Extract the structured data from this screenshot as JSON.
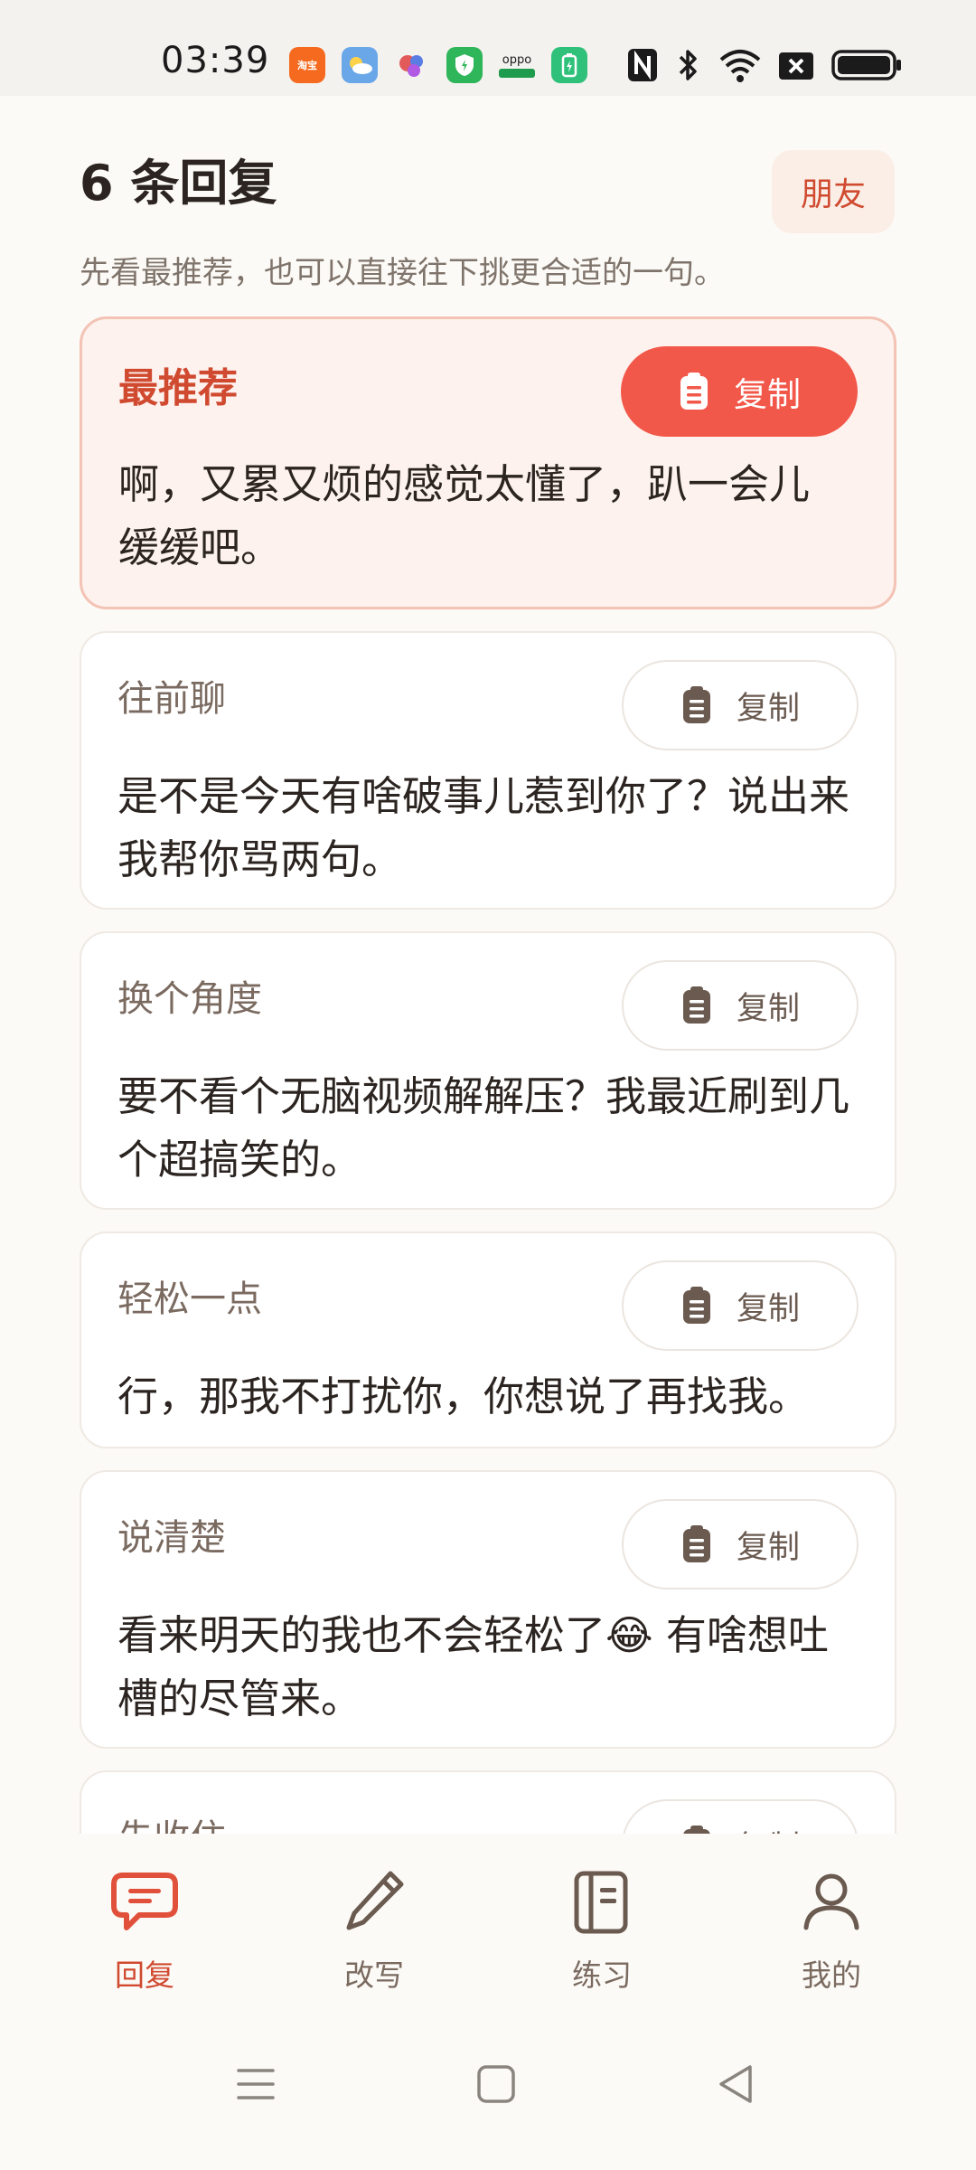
{
  "status_bar": {
    "time": "03:39",
    "app_icons": [
      {
        "name": "taobao-icon",
        "label": "淘宝",
        "color": "#f56a1f"
      },
      {
        "name": "weather-icon",
        "label": "",
        "color": "#6aa7e8"
      },
      {
        "name": "photos-icon",
        "label": "",
        "color": "#e36aa0"
      },
      {
        "name": "security-icon",
        "label": "",
        "color": "#2fb55a"
      },
      {
        "name": "oppo-icon",
        "label": "oppo",
        "color": "#1f9b4d"
      },
      {
        "name": "battery-app-icon",
        "label": "",
        "color": "#2fc17a"
      }
    ]
  },
  "header": {
    "title": "6 条回复",
    "friend_button": "朋友",
    "subtitle": "先看最推荐，也可以直接往下挑更合适的一句。"
  },
  "copy_label": "复制",
  "cards": [
    {
      "label": "最推荐",
      "text_lines": [
        "啊，又累又烦的感觉太懂了，趴一会儿",
        "缓缓吧。"
      ]
    },
    {
      "label": "往前聊",
      "text_lines": [
        "是不是今天有啥破事儿惹到你了？说出来",
        "我帮你骂两句。"
      ]
    },
    {
      "label": "换个角度",
      "text_lines": [
        "要不看个无脑视频解解压？我最近刷到几",
        "个超搞笑的。"
      ]
    },
    {
      "label": "轻松一点",
      "text_lines": [
        "行，那我不打扰你，你想说了再找我。"
      ]
    },
    {
      "label": "说清楚",
      "text_lines": [
        "看来明天的我也不会轻松了😂 有啥想吐",
        "槽的尽管来。"
      ]
    },
    {
      "label": "先收住",
      "text_lines": []
    }
  ],
  "tabs": [
    {
      "label": "回复",
      "icon": "chat-bubble-icon",
      "active": true
    },
    {
      "label": "改写",
      "icon": "pencil-icon",
      "active": false
    },
    {
      "label": "练习",
      "icon": "notebook-icon",
      "active": false
    },
    {
      "label": "我的",
      "icon": "person-icon",
      "active": false
    }
  ],
  "colors": {
    "accent": "#f2584a",
    "accent_text": "#d04a30",
    "background": "#fcfaf6"
  }
}
